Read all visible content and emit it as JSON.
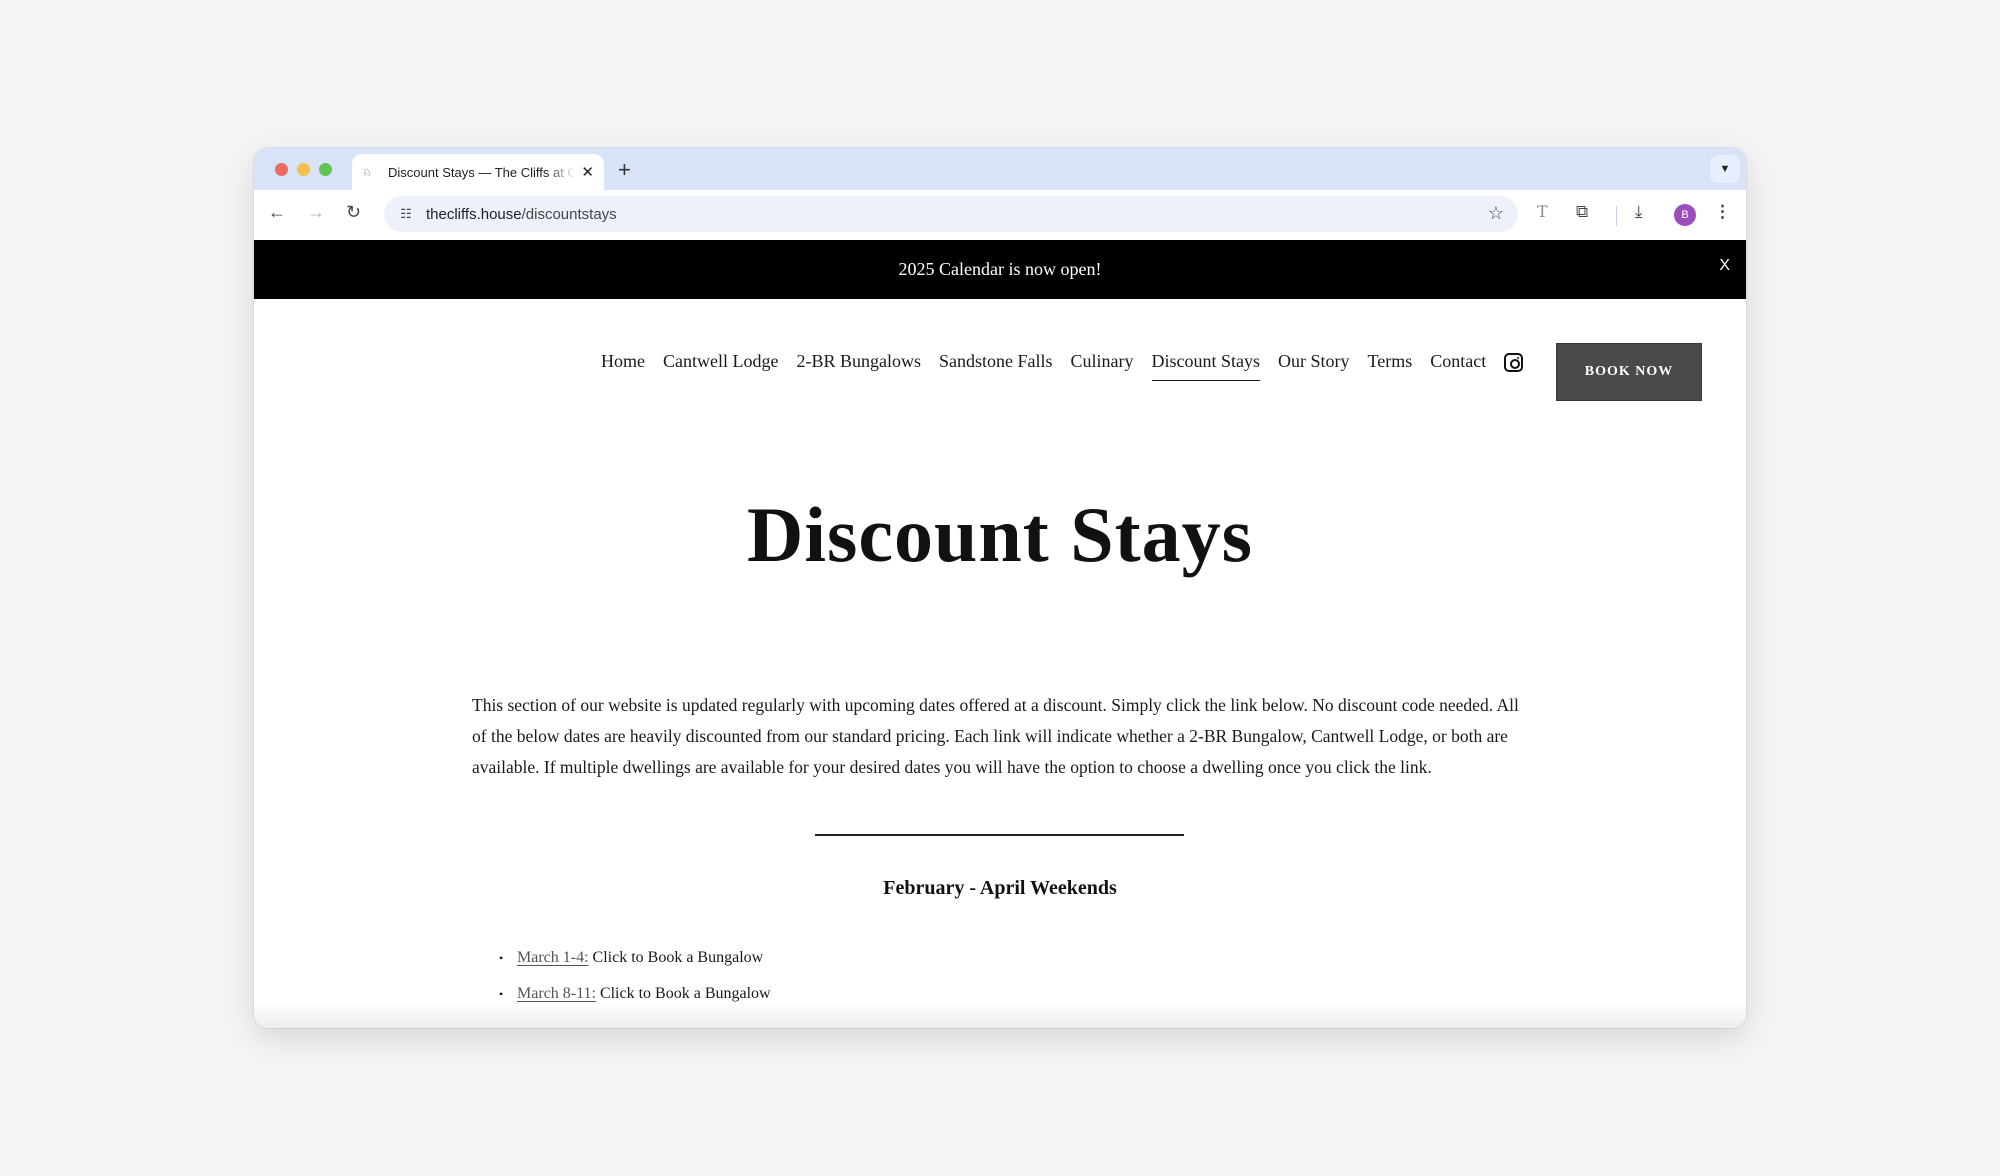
{
  "browser": {
    "tab_title": "Discount Stays — The Cliffs at Cantwell",
    "tab_favicon": "the-cliffs-logo",
    "new_tab_label": "+",
    "url_domain": "thecliffs.house",
    "url_path": "/discountstays",
    "profile_initial": "B",
    "profile_color": "#9a4dbb"
  },
  "icons": {
    "back": "←",
    "forward": "→",
    "reload": "↻",
    "site_info": "☷",
    "star": "☆",
    "translate": "T",
    "extensions": "⧉",
    "download": "⤓",
    "menu": "⋮",
    "close": "✕",
    "chevron": "⌄",
    "bullet": "•"
  },
  "announcement": {
    "text": "2025 Calendar is now open!",
    "close_label": "X"
  },
  "nav": {
    "items": [
      {
        "label": "Home",
        "active": false
      },
      {
        "label": "Cantwell Lodge",
        "active": false
      },
      {
        "label": "2-BR Bungalows",
        "active": false
      },
      {
        "label": "Sandstone Falls",
        "active": false
      },
      {
        "label": "Culinary",
        "active": false
      },
      {
        "label": "Discount Stays",
        "active": true
      },
      {
        "label": "Our Story",
        "active": false
      },
      {
        "label": "Terms",
        "active": false
      },
      {
        "label": "Contact",
        "active": false
      }
    ],
    "book_button": "BOOK NOW"
  },
  "main": {
    "title": "Discount Stays",
    "intro": "This section of our website is updated regularly with upcoming dates offered at a discount. Simply click the link below. No discount code needed. All of the below dates are heavily discounted from our standard pricing. Each link will indicate whether a 2-BR Bungalow, Cantwell Lodge, or both are available. If multiple dwellings are available for your desired dates you will have the option to choose a dwelling once you click the link.",
    "section_heading": "February - April Weekends",
    "dates": [
      {
        "link": "March 1-4:",
        "text": "Click to Book a Bungalow"
      },
      {
        "link": "March 8-11:",
        "text": "Click to Book a Bungalow"
      }
    ]
  }
}
